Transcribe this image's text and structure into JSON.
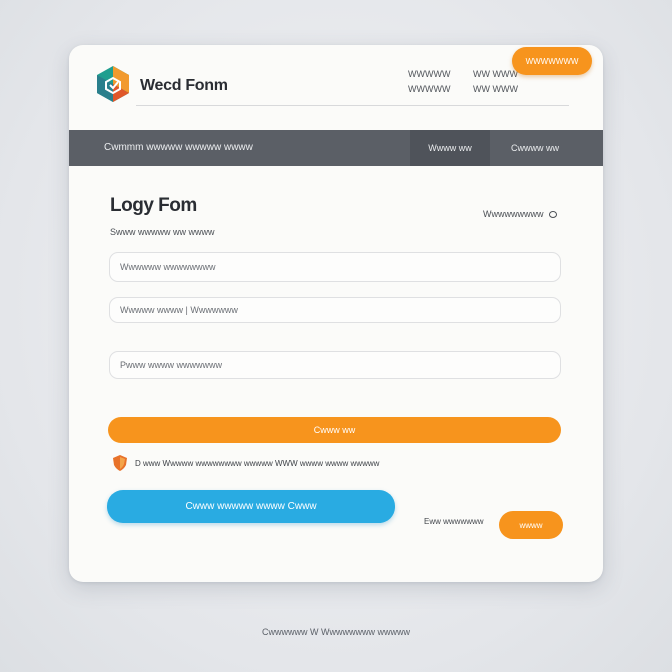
{
  "header": {
    "brand": "Wecd Fonm",
    "contact_lines": [
      {
        "label": "WWWWW",
        "value": "WW WWW"
      },
      {
        "label": "WWWWW",
        "value": "WW WWW"
      }
    ],
    "cta_label": "WWWWWWW"
  },
  "navbar": {
    "title": "Cwmmm wwwww wwwww wwww",
    "items": [
      "Wwww ww",
      "Cwwww ww"
    ]
  },
  "form": {
    "title": "Logy Fom",
    "subtitle": "Swww wwwww ww wwww",
    "help_link": "Wwwwwwwww",
    "fields": [
      {
        "placeholder": "Wwwwww wwwwwwww"
      },
      {
        "placeholder": "Wwwww wwww | Wwwwwww"
      },
      {
        "placeholder": "Pwww wwww wwwwwww"
      }
    ],
    "primary_button": "Cwww ww",
    "agree_text": "D www Wwwww wwwwwwww wwwww WWW wwww wwww wwwww",
    "secondary_button": "Cwww wwwww wwww Cwww",
    "bottom_text": "Eww wwwwwww",
    "small_button": "wwww"
  },
  "footer": {
    "text": "Cwwwwww W Wwwwwwww wwwww"
  },
  "colors": {
    "accent_orange": "#f7941d",
    "accent_blue": "#29abe2",
    "navbar": "#5b5f66"
  }
}
